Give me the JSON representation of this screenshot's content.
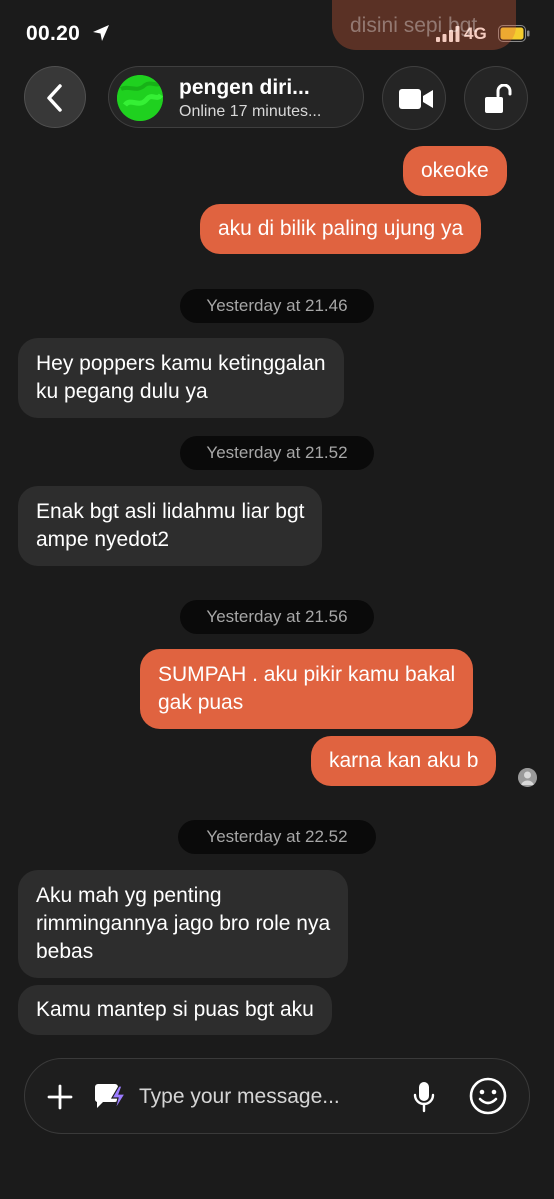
{
  "status_bar": {
    "time": "00.20",
    "network": "4G"
  },
  "ghost_bubble": {
    "text": "disini sepi bgt"
  },
  "header": {
    "contact_name": "pengen diri...",
    "contact_status": "Online 17 minutes..."
  },
  "messages": [
    {
      "type": "out",
      "lines": [
        "okeoke"
      ]
    },
    {
      "type": "out",
      "lines": [
        "aku di bilik paling ujung ya"
      ]
    },
    {
      "type": "stamp",
      "text": "Yesterday at 21.46"
    },
    {
      "type": "in",
      "lines": [
        "Hey poppers kamu ketinggalan",
        "ku pegang dulu ya"
      ]
    },
    {
      "type": "stamp",
      "text": "Yesterday at 21.52"
    },
    {
      "type": "in",
      "lines": [
        "Enak bgt asli lidahmu liar bgt",
        "ampe nyedot2"
      ]
    },
    {
      "type": "stamp",
      "text": "Yesterday at 21.56"
    },
    {
      "type": "out",
      "lines": [
        "SUMPAH . aku pikir kamu bakal",
        "gak puas"
      ]
    },
    {
      "type": "out",
      "lines": [
        "karna kan aku b"
      ]
    },
    {
      "type": "stamp",
      "text": "Yesterday at 22.52"
    },
    {
      "type": "in",
      "lines": [
        "Aku mah yg penting",
        "rimmingannya jago bro role nya",
        "bebas"
      ]
    },
    {
      "type": "in",
      "lines": [
        "Kamu mantep si puas bgt aku"
      ]
    }
  ],
  "composer": {
    "placeholder": "Type your message..."
  },
  "colors": {
    "outgoing": "#e06340",
    "incoming": "#2d2d2d",
    "background": "#1b1b1b"
  },
  "icons": [
    "location-arrow-icon",
    "signal-icon",
    "battery-icon",
    "back-chevron-icon",
    "video-call-icon",
    "unlock-icon",
    "plus-icon",
    "spark-message-icon",
    "microphone-icon",
    "emoji-icon"
  ]
}
